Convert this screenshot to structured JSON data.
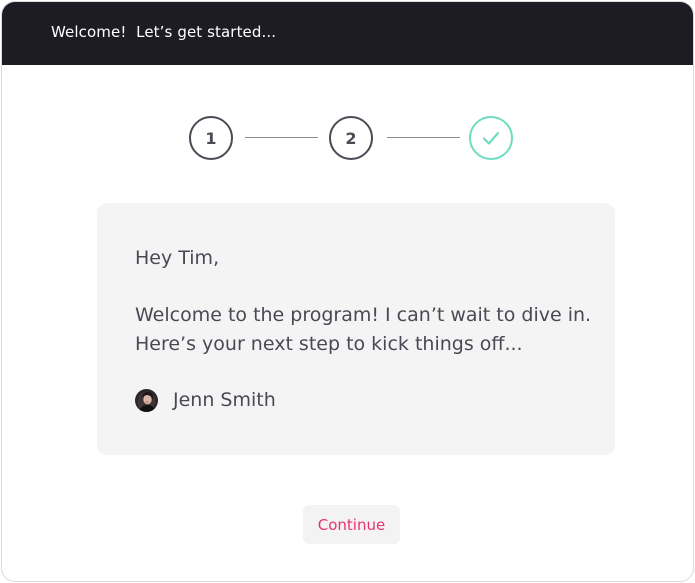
{
  "header": {
    "title": "Welcome!  Let’s get started..."
  },
  "stepper": {
    "steps": [
      {
        "label": "1",
        "state": "incomplete"
      },
      {
        "label": "2",
        "state": "incomplete"
      },
      {
        "label": "",
        "state": "complete",
        "icon": "checkmark-icon"
      }
    ],
    "complete_color": "#6fdcc0",
    "default_color": "#4b4a55"
  },
  "card": {
    "greeting": "Hey Tim,",
    "message_lines": [
      "Welcome to the program!  I can’t wait to dive in.",
      "Here’s your next step to kick things off..."
    ],
    "signature": {
      "avatar": "avatar-photo",
      "name": "Jenn Smith"
    }
  },
  "actions": {
    "continue_label": "Continue",
    "accent_color": "#e8336f"
  }
}
